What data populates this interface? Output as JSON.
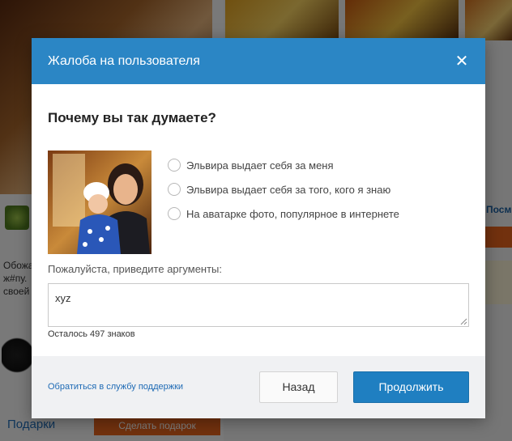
{
  "background": {
    "left_text": "Обожа ж#пу. своей",
    "right_link": "Посм",
    "gifts_title": "Подарки",
    "gift_button": "Сделать подарок"
  },
  "modal": {
    "title": "Жалоба на пользователя",
    "question": "Почему вы так думаете?",
    "options": [
      {
        "label": "Эльвира выдает себя за меня",
        "selected": false
      },
      {
        "label": "Эльвира выдает себя за того, кого я знаю",
        "selected": false
      },
      {
        "label": "На аватарке фото, популярное в интернете",
        "selected": false
      }
    ],
    "arguments_label": "Пожалуйста, приведите аргументы:",
    "arguments_value": "xyz",
    "counter_text": "Осталось 497 знаков",
    "support_link": "Обратиться в службу поддержки",
    "back_button": "Назад",
    "continue_button": "Продолжить"
  },
  "icons": {
    "close": "close-icon",
    "radio": "radio-icon",
    "resize": "resize-grip-icon"
  },
  "colors": {
    "header": "#2b86c5",
    "primary_button": "#1f7fc1",
    "link": "#1f6bb5",
    "accent_orange": "#e4621c"
  }
}
